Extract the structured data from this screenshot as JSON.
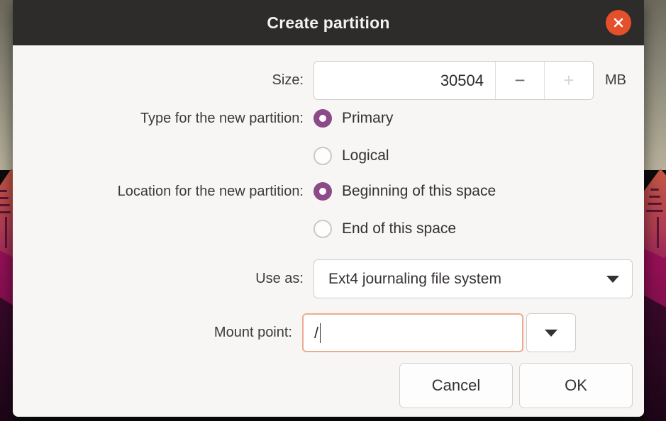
{
  "window": {
    "title": "Create partition",
    "close_icon": "close-icon",
    "close_glyph": "✕",
    "titlebar_color": "#2e2c2b",
    "close_color": "#e4502b"
  },
  "accent": {
    "radio_selected": "#8d4a89",
    "focus_border": "#eeab8d"
  },
  "form": {
    "size": {
      "label": "Size:",
      "value": "30504",
      "unit": "MB",
      "decrement_label": "−",
      "increment_label": "+",
      "decrement_enabled": true,
      "increment_enabled": false
    },
    "type": {
      "label": "Type for the new partition:",
      "options": [
        {
          "label": "Primary",
          "selected": true
        },
        {
          "label": "Logical",
          "selected": false
        }
      ]
    },
    "location": {
      "label": "Location for the new partition:",
      "options": [
        {
          "label": "Beginning of this space",
          "selected": true
        },
        {
          "label": "End of this space",
          "selected": false
        }
      ]
    },
    "use_as": {
      "label": "Use as:",
      "value": "Ext4 journaling file system",
      "arrow_icon": "chevron-down-icon"
    },
    "mount_point": {
      "label": "Mount point:",
      "value": "/",
      "focused": true,
      "arrow_icon": "chevron-down-icon"
    }
  },
  "actions": {
    "cancel_label": "Cancel",
    "ok_label": "OK"
  }
}
